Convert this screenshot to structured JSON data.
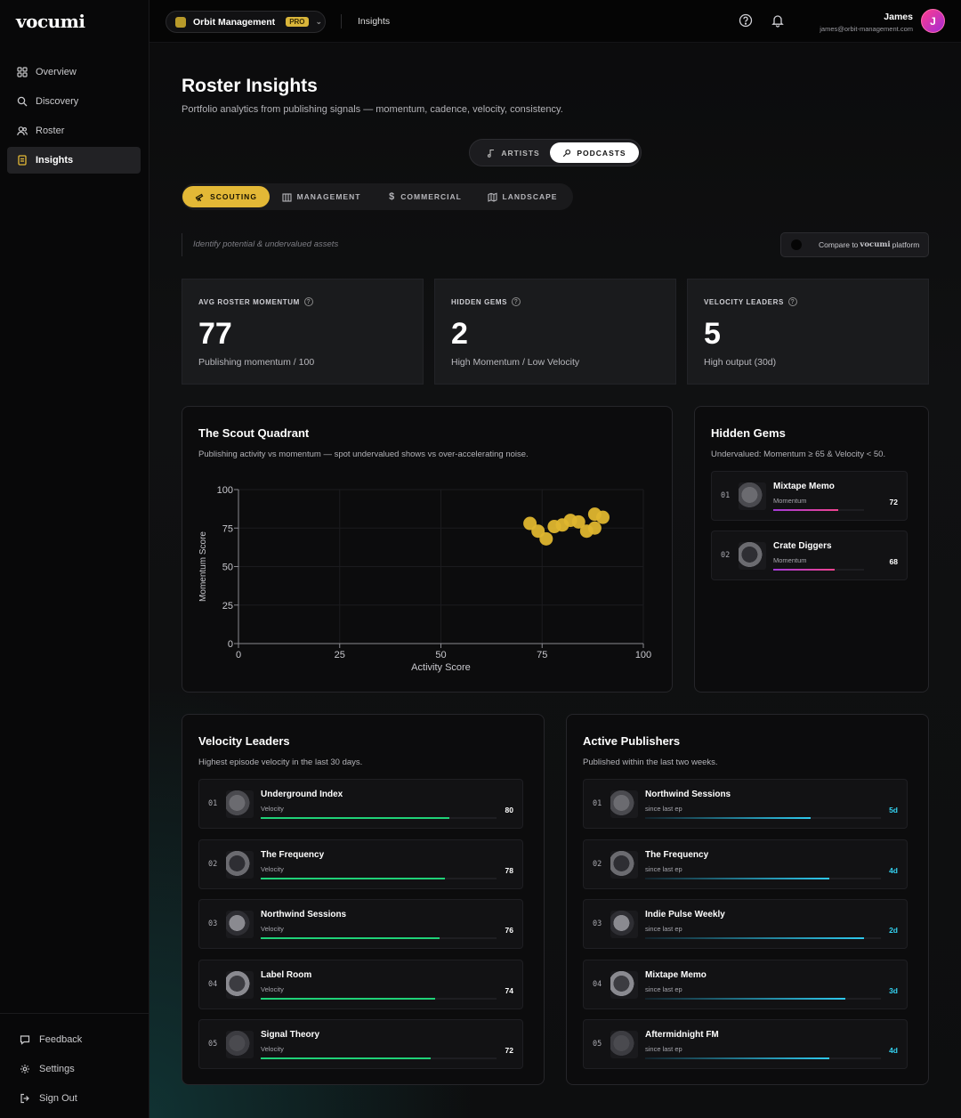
{
  "app": {
    "logo": "vocumi"
  },
  "sidebar": {
    "items": [
      {
        "label": "Overview",
        "icon": "grid-icon"
      },
      {
        "label": "Discovery",
        "icon": "search-icon"
      },
      {
        "label": "Roster",
        "icon": "users-icon"
      },
      {
        "label": "Insights",
        "icon": "document-icon",
        "active": true
      }
    ],
    "bottom": [
      {
        "label": "Feedback",
        "icon": "chat-icon"
      },
      {
        "label": "Settings",
        "icon": "gear-icon"
      },
      {
        "label": "Sign Out",
        "icon": "sign-out-icon"
      }
    ]
  },
  "topbar": {
    "org_name": "Orbit Management",
    "org_badge": "PRO",
    "breadcrumb": "Insights",
    "user_name": "James",
    "user_email": "james@orbit-management.com",
    "avatar_initial": "J"
  },
  "header": {
    "title": "Roster Insights",
    "subtitle": "Portfolio analytics from publishing signals — momentum, cadence, velocity, consistency."
  },
  "segment": {
    "artists": "ARTISTS",
    "podcasts": "PODCASTS",
    "selected": "PODCASTS"
  },
  "tabs": [
    {
      "label": "SCOUTING",
      "icon": "telescope-icon",
      "active": true
    },
    {
      "label": "MANAGEMENT",
      "icon": "building-icon"
    },
    {
      "label": "COMMERCIAL",
      "icon": "dollar-icon"
    },
    {
      "label": "LANDSCAPE",
      "icon": "map-icon"
    }
  ],
  "hint": "Identify potential & undervalued assets",
  "compare": {
    "prefix": "Compare to",
    "brand": "vocumi",
    "suffix": "platform"
  },
  "stats": [
    {
      "label": "AVG ROSTER MOMENTUM",
      "value": "77",
      "sub": "Publishing momentum / 100"
    },
    {
      "label": "HIDDEN GEMS",
      "value": "2",
      "sub": "High Momentum / Low Velocity"
    },
    {
      "label": "VELOCITY LEADERS",
      "value": "5",
      "sub": "High output (30d)"
    }
  ],
  "scout": {
    "title": "The Scout Quadrant",
    "subtitle": "Publishing activity vs momentum — spot undervalued shows vs over-accelerating noise."
  },
  "chart_data": {
    "type": "scatter",
    "title": "The Scout Quadrant",
    "xlabel": "Activity Score",
    "ylabel": "Momentum Score",
    "xlim": [
      0,
      100
    ],
    "ylim": [
      0,
      100
    ],
    "xticks": [
      "0",
      "25",
      "50",
      "75",
      "100"
    ],
    "yticks": [
      "0",
      "25",
      "50",
      "75",
      "100"
    ],
    "grid": true,
    "color": "#dfb62f",
    "points": [
      {
        "x": 72,
        "y": 78
      },
      {
        "x": 74,
        "y": 73
      },
      {
        "x": 76,
        "y": 68
      },
      {
        "x": 78,
        "y": 76
      },
      {
        "x": 80,
        "y": 77
      },
      {
        "x": 82,
        "y": 80
      },
      {
        "x": 84,
        "y": 79
      },
      {
        "x": 86,
        "y": 73
      },
      {
        "x": 88,
        "y": 75
      },
      {
        "x": 88,
        "y": 84
      },
      {
        "x": 90,
        "y": 82
      }
    ]
  },
  "gems": {
    "title": "Hidden Gems",
    "subtitle": "Undervalued: Momentum ≥ 65 & Velocity < 50.",
    "rows": [
      {
        "rank": "01",
        "name": "Mixtape Memo",
        "meta": "Momentum",
        "value": "72",
        "pct": 72
      },
      {
        "rank": "02",
        "name": "Crate Diggers",
        "meta": "Momentum",
        "value": "68",
        "pct": 68
      }
    ]
  },
  "velocity": {
    "title": "Velocity Leaders",
    "subtitle": "Highest episode velocity in the last 30 days.",
    "rows": [
      {
        "rank": "01",
        "name": "Underground Index",
        "meta": "Velocity",
        "value": "80",
        "pct": 80
      },
      {
        "rank": "02",
        "name": "The Frequency",
        "meta": "Velocity",
        "value": "78",
        "pct": 78
      },
      {
        "rank": "03",
        "name": "Northwind Sessions",
        "meta": "Velocity",
        "value": "76",
        "pct": 76
      },
      {
        "rank": "04",
        "name": "Label Room",
        "meta": "Velocity",
        "value": "74",
        "pct": 74
      },
      {
        "rank": "05",
        "name": "Signal Theory",
        "meta": "Velocity",
        "value": "72",
        "pct": 72
      }
    ]
  },
  "active": {
    "title": "Active Publishers",
    "subtitle": "Published within the last two weeks.",
    "rows": [
      {
        "rank": "01",
        "name": "Northwind Sessions",
        "meta": "since last ep",
        "value": "5d",
        "pct": 70
      },
      {
        "rank": "02",
        "name": "The Frequency",
        "meta": "since last ep",
        "value": "4d",
        "pct": 78
      },
      {
        "rank": "03",
        "name": "Indie Pulse Weekly",
        "meta": "since last ep",
        "value": "2d",
        "pct": 93
      },
      {
        "rank": "04",
        "name": "Mixtape Memo",
        "meta": "since last ep",
        "value": "3d",
        "pct": 85
      },
      {
        "rank": "05",
        "name": "Aftermidnight FM",
        "meta": "since last ep",
        "value": "4d",
        "pct": 78
      }
    ]
  }
}
